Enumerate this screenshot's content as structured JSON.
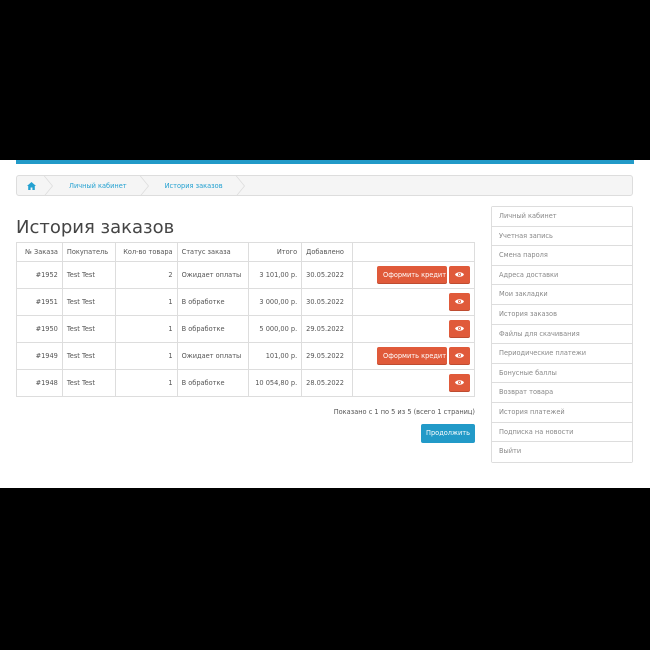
{
  "breadcrumb": {
    "items": [
      "Личный кабинет",
      "История заказов"
    ]
  },
  "page": {
    "title": "История заказов"
  },
  "table": {
    "headers": [
      "№ Заказа",
      "Покупатель",
      "Кол-во товара",
      "Статус заказа",
      "Итого",
      "Добавлено",
      ""
    ],
    "rows": [
      {
        "id": "#1952",
        "customer": "Test Test",
        "qty": "2",
        "status": "Ожидает оплаты",
        "total": "3 101,00 р.",
        "date": "30.05.2022",
        "credit": true
      },
      {
        "id": "#1951",
        "customer": "Test Test",
        "qty": "1",
        "status": "В обработке",
        "total": "3 000,00 р.",
        "date": "30.05.2022",
        "credit": false
      },
      {
        "id": "#1950",
        "customer": "Test Test",
        "qty": "1",
        "status": "В обработке",
        "total": "5 000,00 р.",
        "date": "29.05.2022",
        "credit": false
      },
      {
        "id": "#1949",
        "customer": "Test Test",
        "qty": "1",
        "status": "Ожидает оплаты",
        "total": "101,00 р.",
        "date": "29.05.2022",
        "credit": true
      },
      {
        "id": "#1948",
        "customer": "Test Test",
        "qty": "1",
        "status": "В обработке",
        "total": "10 054,80 р.",
        "date": "28.05.2022",
        "credit": false
      }
    ],
    "credit_label": "Оформить кредит"
  },
  "pagination": {
    "text": "Показано с 1 по 5 из 5 (всего 1 страниц)"
  },
  "continue_label": "Продолжить",
  "sidebar": {
    "items": [
      "Личный кабинет",
      "Учетная запись",
      "Смена пароля",
      "Адреса доставки",
      "Мои закладки",
      "История заказов",
      "Файлы для скачивания",
      "Периодические платежи",
      "Бонусные баллы",
      "Возврат товара",
      "История платежей",
      "Подписка на новости",
      "Выйти"
    ]
  },
  "colors": {
    "accent": "#229ac8",
    "danger": "#e05a3a"
  }
}
